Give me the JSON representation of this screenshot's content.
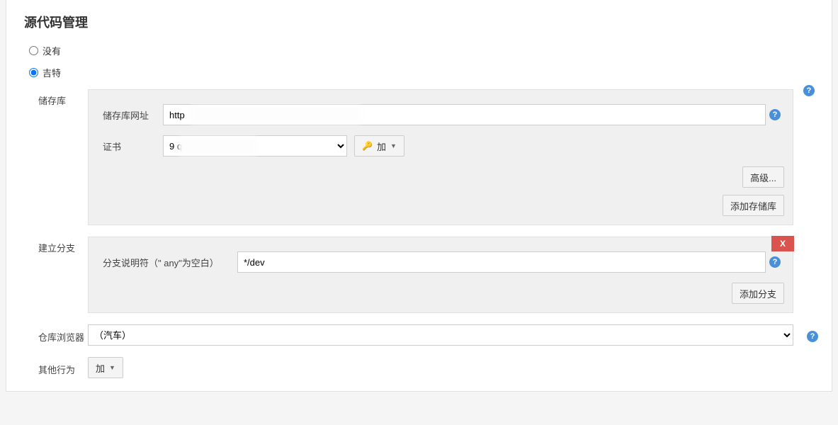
{
  "section": {
    "title": "源代码管理"
  },
  "scm": {
    "none_label": "没有",
    "git_label": "吉特",
    "selected": "git"
  },
  "repositories": {
    "label": "储存库",
    "url_label": "储存库网址",
    "url_value": "http",
    "credentials_label": "证书",
    "credentials_selected": "9                        qq.com/******",
    "add_cred_label": "加",
    "advanced_btn": "高级...",
    "add_repo_btn": "添加存储库"
  },
  "branches": {
    "label": "建立分支",
    "specifier_label": "分支说明符（\" any\"为空白）",
    "specifier_value": "*/dev",
    "delete_label": "X",
    "add_branch_btn": "添加分支"
  },
  "repo_browser": {
    "label": "仓库浏览器",
    "selected": "（汽车）"
  },
  "additional": {
    "label": "其他行为",
    "add_btn": "加"
  },
  "icons": {
    "help": "?",
    "caret": "▼",
    "key": "🔑"
  }
}
